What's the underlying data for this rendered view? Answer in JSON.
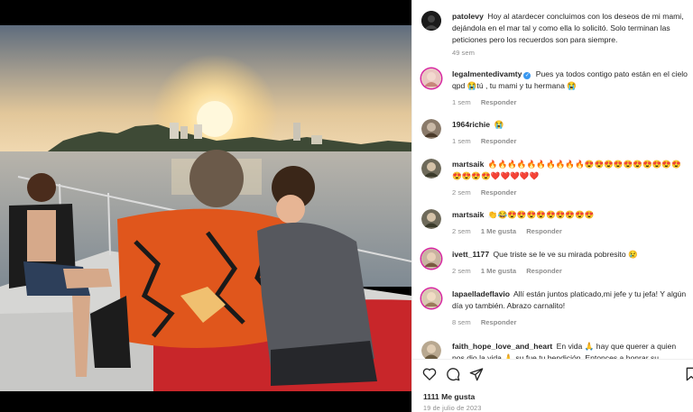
{
  "post": {
    "likes_label": "1111 Me gusta",
    "date": "19 de julio de 2023"
  },
  "comments": [
    {
      "username": "patolevy",
      "text": "Hoy al atardecer concluimos con los deseos de mi mami, dejándola en el mar tal y como ella lo solicitó. Solo terminan las peticiones pero los recuerdos son para siempre.",
      "time": "49 sem"
    },
    {
      "username": "legalmentedivamty",
      "verified": true,
      "text": "Pues ya todos contigo pato están en el cielo qpd 😭tú , tu mami y tu hermana 😭",
      "time": "1 sem",
      "reply": "Responder"
    },
    {
      "username": "1964richie",
      "text": "😭",
      "time": "1 sem",
      "reply": "Responder"
    },
    {
      "username": "martsaik",
      "text": "🔥🔥🔥🔥🔥🔥🔥🔥🔥🔥😍😍😍😍😍😍😍😍😍😍😍😍😍😍❤️❤️❤️❤️❤️",
      "time": "2 sem",
      "reply": "Responder"
    },
    {
      "username": "martsaik",
      "text": "👏😂😍😍😍😍😍😍😍😍😍",
      "time": "2 sem",
      "likes": "1 Me gusta",
      "reply": "Responder"
    },
    {
      "username": "ivett_1177",
      "text": "Que triste se le ve su mirada pobresito 😢",
      "time": "2 sem",
      "likes": "1 Me gusta",
      "reply": "Responder"
    },
    {
      "username": "lapaelladeflavio",
      "text": "Allí están juntos platicado,mi jefe y tu jefa! Y algún día yo también. Abrazo carnalito!",
      "time": "8 sem",
      "reply": "Responder"
    },
    {
      "username": "faith_hope_love_and_heart",
      "text": "En vida 🙏 hay que querer a quien nos dio la vida 🙏 su fue tu bendición. Entonces a honrar su",
      "time": "",
      "reply": ""
    }
  ],
  "icons": [
    "heart-icon",
    "comment-icon",
    "share-icon",
    "bookmark-icon"
  ],
  "colors": {
    "accent": "#3897f0",
    "muted": "#8e8e8e",
    "text": "#262626"
  }
}
